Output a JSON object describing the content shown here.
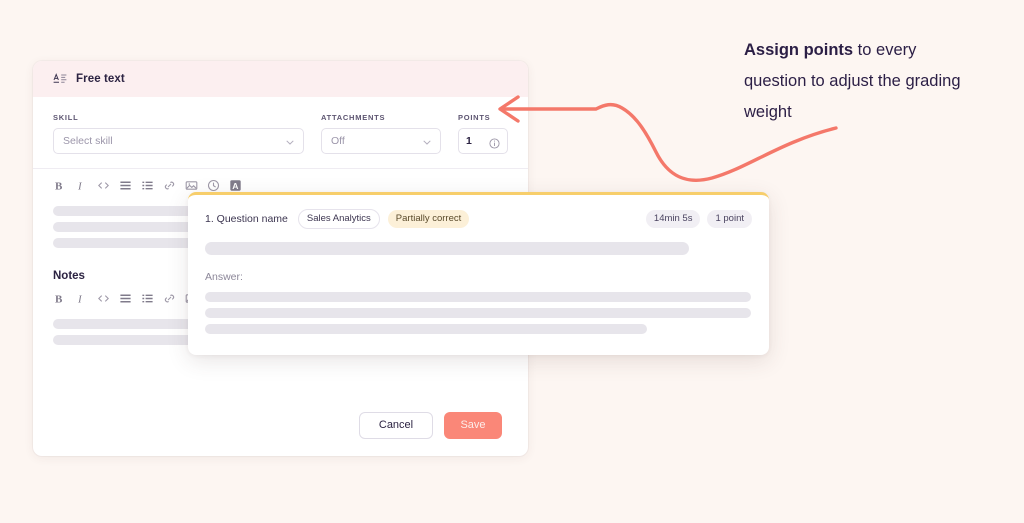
{
  "background_color": "#FDF6F2",
  "accent_colors": {
    "coral": "#FA8778",
    "header_pink": "#FCEFF0",
    "card_top_border": "#F7CE6B",
    "status_badge_bg": "#FCF0D8",
    "skeleton": "#E7E5EB"
  },
  "editor": {
    "header": {
      "title": "Free text",
      "icon": "free-text-icon"
    },
    "fields": {
      "skill": {
        "label": "SKILL",
        "value": "",
        "placeholder": "Select skill",
        "chevron": "chevron-down-icon"
      },
      "attachments": {
        "label": "ATTACHMENTS",
        "value": "Off",
        "chevron": "chevron-down-icon"
      },
      "points": {
        "label": "POINTS",
        "value": "1",
        "info_icon": "info-icon"
      }
    },
    "toolbar": {
      "items": [
        {
          "name": "bold-icon",
          "glyph": "B"
        },
        {
          "name": "italic-icon",
          "glyph": "I"
        },
        {
          "name": "code-icon",
          "glyph": "</>"
        },
        {
          "name": "bullet-list-icon",
          "glyph": "☰"
        },
        {
          "name": "numbered-list-icon",
          "glyph": "≡"
        },
        {
          "name": "link-icon",
          "glyph": "ὑ7"
        },
        {
          "name": "image-icon",
          "glyph": "ὛC"
        },
        {
          "name": "clock-icon",
          "glyph": "ὕ1"
        },
        {
          "name": "text-highlight-icon",
          "glyph": "A"
        }
      ]
    },
    "notes": {
      "title": "Notes"
    },
    "footer": {
      "cancel_label": "Cancel",
      "save_label": "Save"
    }
  },
  "overlay": {
    "question_name": "1. Question name",
    "skill_badge": "Sales Analytics",
    "status_badge": "Partially correct",
    "duration_badge": "14min 5s",
    "points_badge": "1 point",
    "answer_label": "Answer:"
  },
  "annotation": {
    "bold_part": "Assign points",
    "rest_part": " to every question to adjust the grading weight",
    "arrow": "curved-arrow-icon"
  }
}
